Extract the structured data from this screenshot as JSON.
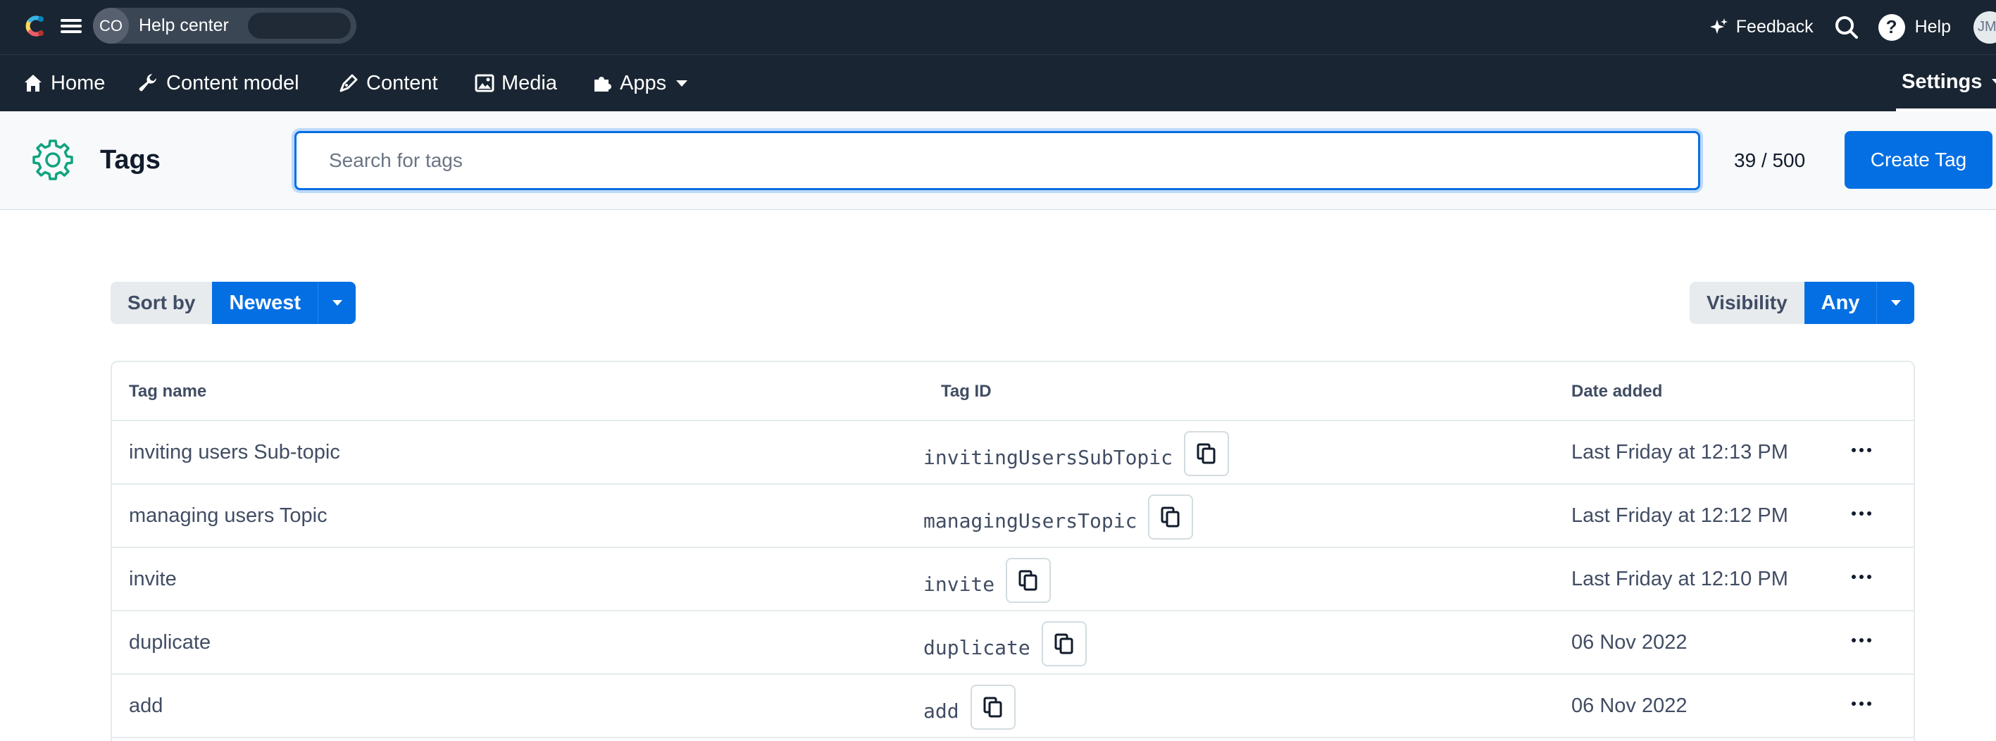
{
  "app": {
    "space_initials": "CO",
    "space_name": "Help center"
  },
  "topbar": {
    "feedback_label": "Feedback",
    "help_label": "Help",
    "user_initials": "JM"
  },
  "nav": {
    "items": [
      {
        "label": "Home",
        "icon": "home-icon"
      },
      {
        "label": "Content model",
        "icon": "wrench-icon"
      },
      {
        "label": "Content",
        "icon": "pen-icon"
      },
      {
        "label": "Media",
        "icon": "image-icon"
      },
      {
        "label": "Apps",
        "icon": "puzzle-icon"
      }
    ],
    "settings_label": "Settings"
  },
  "header": {
    "title": "Tags",
    "search_placeholder": "Search for tags",
    "count": "39 / 500",
    "create_label": "Create Tag"
  },
  "controls": {
    "sort_label": "Sort by",
    "sort_value": "Newest",
    "visibility_label": "Visibility",
    "visibility_value": "Any"
  },
  "table": {
    "columns": [
      "Tag name",
      "Tag ID",
      "Date added"
    ],
    "rows": [
      {
        "name": "inviting users Sub-topic",
        "id": "invitingUsersSubTopic",
        "date": "Last Friday at 12:13 PM"
      },
      {
        "name": "managing users Topic",
        "id": "managingUsersTopic",
        "date": "Last Friday at 12:12 PM"
      },
      {
        "name": "invite",
        "id": "invite",
        "date": "Last Friday at 12:10 PM"
      },
      {
        "name": "duplicate",
        "id": "duplicate",
        "date": "06 Nov 2022"
      },
      {
        "name": "add",
        "id": "add",
        "date": "06 Nov 2022"
      }
    ]
  },
  "colors": {
    "topbar_bg": "#192532",
    "primary": "#036fe3",
    "header_bg": "#f7f9fa",
    "text": "#414d63"
  }
}
